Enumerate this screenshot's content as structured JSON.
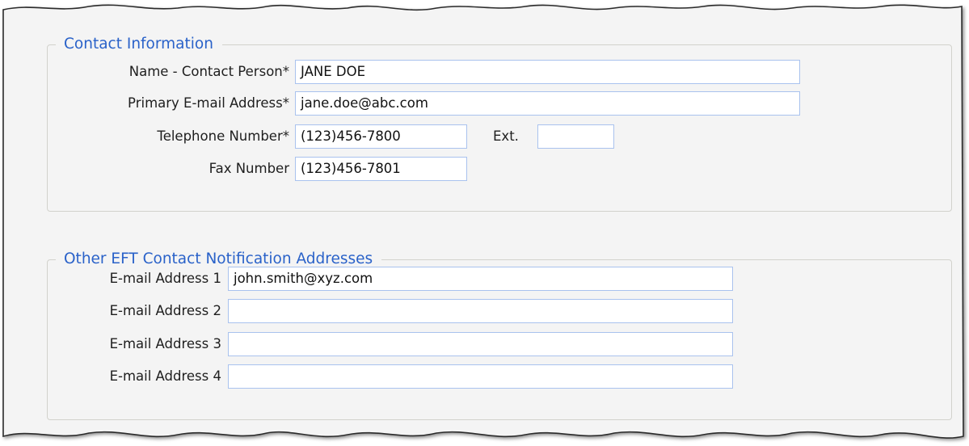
{
  "contact_information": {
    "legend": "Contact Information",
    "name_label": "Name - Contact Person*",
    "name_value": "JANE DOE",
    "email_label": "Primary E-mail Address*",
    "email_value": "jane.doe@abc.com",
    "telephone_label": "Telephone Number*",
    "telephone_value": "(123)456-7800",
    "ext_label": "Ext.",
    "ext_value": "",
    "fax_label": "Fax Number",
    "fax_value": "(123)456-7801"
  },
  "other_eft": {
    "legend": "Other EFT Contact Notification Addresses",
    "addresses": [
      {
        "label": "E-mail Address 1",
        "value": "john.smith@xyz.com"
      },
      {
        "label": "E-mail Address 2",
        "value": ""
      },
      {
        "label": "E-mail Address 3",
        "value": ""
      },
      {
        "label": "E-mail Address 4",
        "value": ""
      }
    ]
  },
  "colors": {
    "legend_text": "#2a62c9",
    "panel_background": "#f4f4f4",
    "field_border": "#a9c2ee",
    "group_border": "#d2d2cc"
  }
}
